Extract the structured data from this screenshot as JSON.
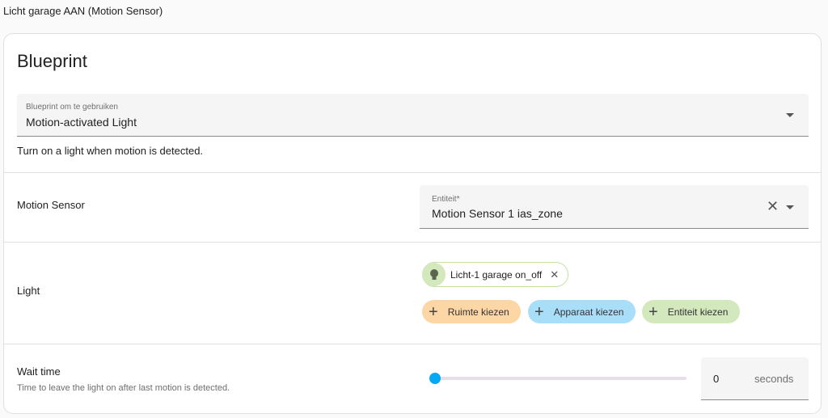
{
  "page_title": "Licht garage AAN (Motion Sensor)",
  "card": {
    "heading": "Blueprint",
    "blueprint_select": {
      "label": "Blueprint om te gebruiken",
      "value": "Motion-activated Light"
    },
    "description": "Turn on a light when motion is detected."
  },
  "motion_sensor": {
    "label": "Motion Sensor",
    "field_label": "Entiteit*",
    "value": "Motion Sensor 1 ias_zone"
  },
  "light": {
    "label": "Light",
    "chip": "Licht-1 garage on_off",
    "buttons": [
      {
        "label": "Ruimte kiezen",
        "color": "#fdd6a5"
      },
      {
        "label": "Apparaat kiezen",
        "color": "#a9def9"
      },
      {
        "label": "Entiteit kiezen",
        "color": "#d4e8be"
      }
    ]
  },
  "wait_time": {
    "label": "Wait time",
    "description": "Time to leave the light on after last motion is detected.",
    "value": "0",
    "unit": "seconds",
    "slider_fraction": 0
  }
}
